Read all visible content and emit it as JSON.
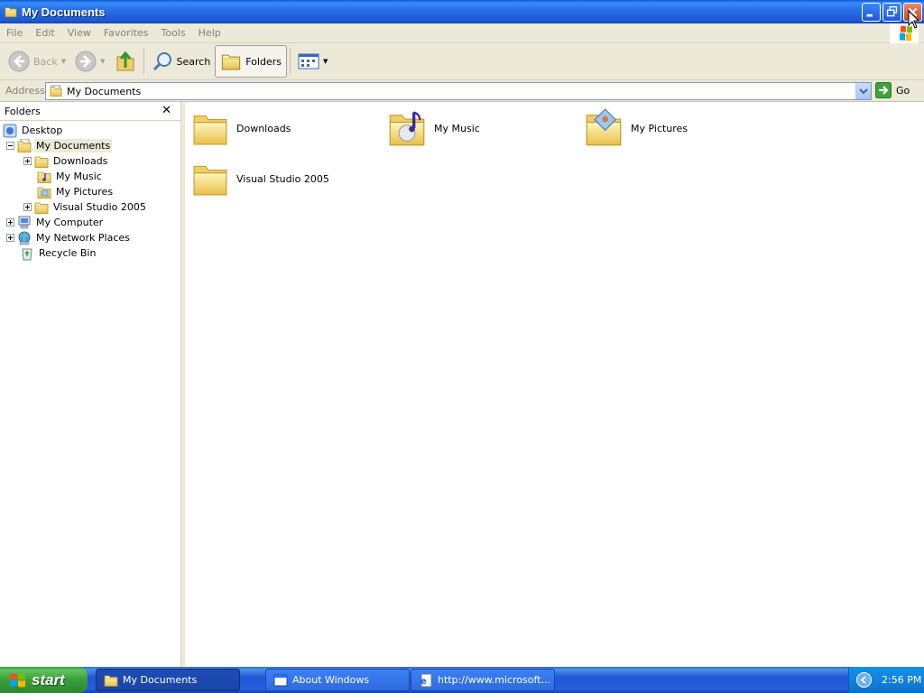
{
  "window": {
    "title": "My Documents"
  },
  "menu": [
    "File",
    "Edit",
    "View",
    "Favorites",
    "Tools",
    "Help"
  ],
  "toolbar": {
    "back_label": "Back",
    "search_label": "Search",
    "folders_label": "Folders"
  },
  "address": {
    "label": "Address",
    "value": "My Documents",
    "go_label": "Go"
  },
  "folders_pane": {
    "header": "Folders",
    "tree": [
      {
        "label": "Desktop",
        "icon": "desktop-icon"
      },
      {
        "label": "My Documents",
        "icon": "my-documents-icon"
      },
      {
        "label": "Downloads",
        "icon": "folder-icon"
      },
      {
        "label": "My Music",
        "icon": "music-folder-icon"
      },
      {
        "label": "My Pictures",
        "icon": "pictures-folder-icon"
      },
      {
        "label": "Visual Studio 2005",
        "icon": "folder-icon"
      },
      {
        "label": "My Computer",
        "icon": "computer-icon"
      },
      {
        "label": "My Network Places",
        "icon": "network-icon"
      },
      {
        "label": "Recycle Bin",
        "icon": "recycle-bin-icon"
      }
    ]
  },
  "content": {
    "items": [
      {
        "label": "Downloads",
        "icon": "folder-icon"
      },
      {
        "label": "My Music",
        "icon": "music-folder-icon"
      },
      {
        "label": "My Pictures",
        "icon": "pictures-folder-icon"
      },
      {
        "label": "Visual Studio 2005",
        "icon": "folder-icon"
      }
    ]
  },
  "taskbar": {
    "start_label": "start",
    "tasks": [
      {
        "label": "My Documents",
        "active": true
      },
      {
        "label": "About Windows",
        "active": false
      },
      {
        "label": "http://www.microsoft...",
        "active": false
      }
    ],
    "clock": "2:56 PM"
  },
  "colors": {
    "titlebar": "#1f5bd6",
    "taskbar": "#245edb",
    "start": "#3a9d3a",
    "chrome": "#ece9d8"
  }
}
